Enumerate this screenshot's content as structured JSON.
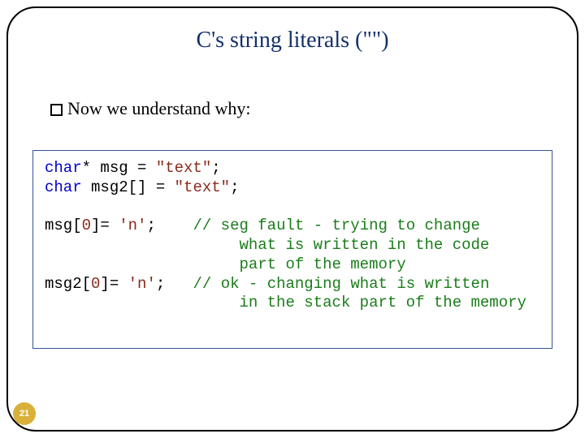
{
  "slide": {
    "title": "C's  string literals (\"\")",
    "bullet": "Now we understand why:",
    "page_number": "21"
  },
  "code": {
    "line1": {
      "kw": "char",
      "rest1": "* msg = ",
      "str": "\"text\"",
      "rest2": ";"
    },
    "line2": {
      "kw": "char",
      "rest1": " msg2[] = ",
      "str": "\"text\"",
      "rest2": ";"
    },
    "line3": {
      "pre": "msg[",
      "num": "0",
      "mid": "]= ",
      "str": "'n'",
      "post": ";",
      "pad": "    ",
      "cm": "// seg fault - trying to change"
    },
    "line3b": {
      "pad": "                     ",
      "cm": "what is written in the code"
    },
    "line3c": {
      "pad": "                     ",
      "cm": "part of the memory"
    },
    "line4": {
      "pre": "msg2[",
      "num": "0",
      "mid": "]= ",
      "str": "'n'",
      "post": ";",
      "pad": "   ",
      "cm": "// ok - changing what is written"
    },
    "line4b": {
      "pad": "                     ",
      "cm": "in the stack part of the memory"
    }
  }
}
